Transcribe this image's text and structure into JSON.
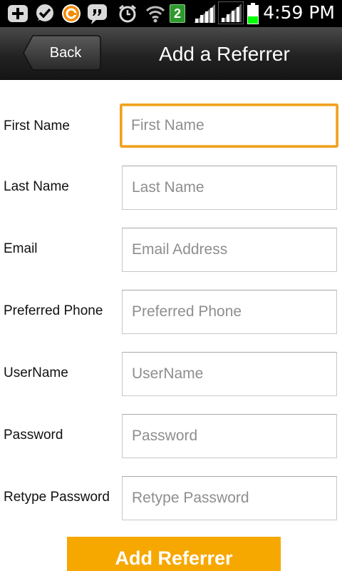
{
  "status_bar": {
    "time": "4:59 PM",
    "notification_badge": "2",
    "icons": [
      "add-icon",
      "checkmark-icon",
      "refresh-icon",
      "chat-icon",
      "alarm-icon",
      "wifi-icon",
      "notification-badge-icon",
      "signal-icon",
      "signal-icon",
      "battery-icon"
    ],
    "battery_color": "#00ff00"
  },
  "title_bar": {
    "back_label": "Back",
    "title": "Add a Referrer"
  },
  "form": {
    "fields": [
      {
        "label": "First Name",
        "placeholder": "First Name"
      },
      {
        "label": "Last Name",
        "placeholder": "Last Name"
      },
      {
        "label": "Email",
        "placeholder": "Email Address"
      },
      {
        "label": "Preferred Phone",
        "placeholder": "Preferred Phone"
      },
      {
        "label": "UserName",
        "placeholder": "UserName"
      },
      {
        "label": "Password",
        "placeholder": "Password"
      },
      {
        "label": "Retype Password",
        "placeholder": "Retype Password"
      }
    ],
    "focused_field": "First Name",
    "focus_color": "#f0a020"
  },
  "submit": {
    "label": "Add Referrer",
    "color": "#f7a800"
  }
}
